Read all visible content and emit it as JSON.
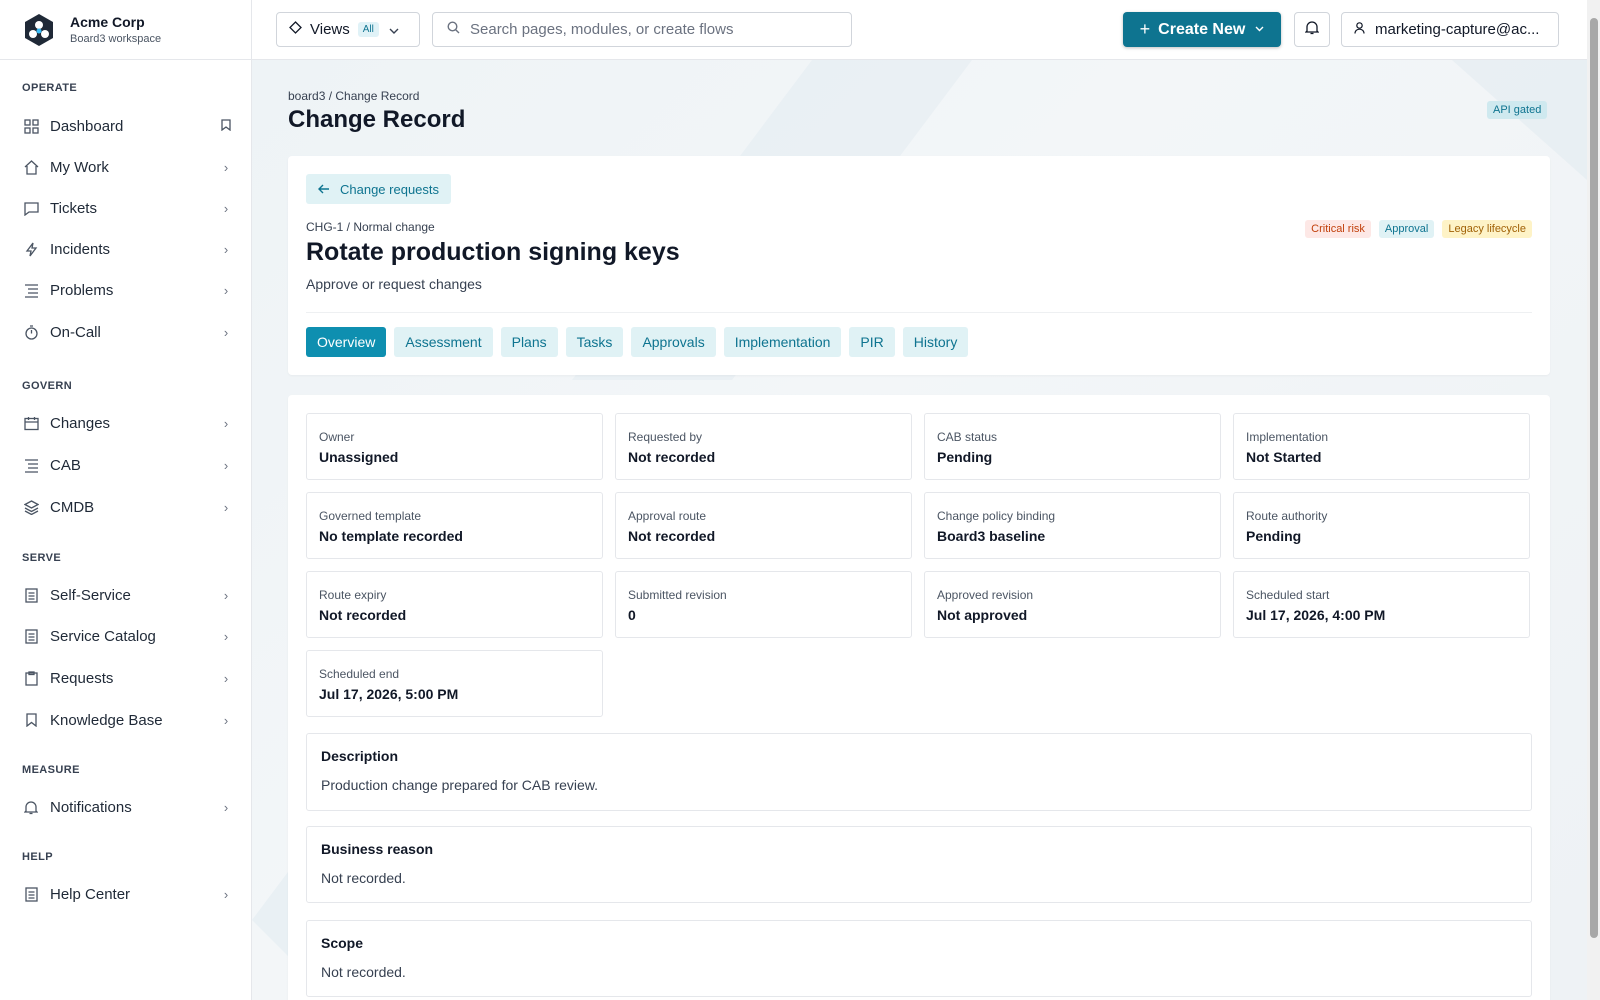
{
  "brand": {
    "name": "Acme Corp",
    "workspace": "Board3 workspace"
  },
  "sidebar": {
    "sections": [
      {
        "label": "OPERATE"
      },
      {
        "label": "GOVERN"
      },
      {
        "label": "SERVE"
      },
      {
        "label": "MEASURE"
      },
      {
        "label": "HELP"
      }
    ],
    "items": [
      {
        "label": "Dashboard",
        "icon": "grid-icon"
      },
      {
        "label": "My Work",
        "icon": "home-icon"
      },
      {
        "label": "Tickets",
        "icon": "chat-icon"
      },
      {
        "label": "Incidents",
        "icon": "bolt-icon"
      },
      {
        "label": "Problems",
        "icon": "list-icon"
      },
      {
        "label": "On-Call",
        "icon": "stopwatch-icon"
      },
      {
        "label": "Changes",
        "icon": "calendar-icon"
      },
      {
        "label": "CAB",
        "icon": "list-icon"
      },
      {
        "label": "CMDB",
        "icon": "layers-icon"
      },
      {
        "label": "Self-Service",
        "icon": "document-icon"
      },
      {
        "label": "Service Catalog",
        "icon": "document-icon"
      },
      {
        "label": "Requests",
        "icon": "clipboard-icon"
      },
      {
        "label": "Knowledge Base",
        "icon": "bookmark-icon"
      },
      {
        "label": "Notifications",
        "icon": "bell-icon"
      },
      {
        "label": "Help Center",
        "icon": "document-icon"
      }
    ]
  },
  "topbar": {
    "views_label": "Views",
    "views_badge": "All",
    "search_placeholder": "Search pages, modules, or create flows",
    "create_label": "Create New",
    "user_label": "marketing-capture@ac..."
  },
  "page": {
    "breadcrumb": "board3 / Change Record",
    "title": "Change Record",
    "api_badge": "API gated"
  },
  "record": {
    "back_label": "Change requests",
    "id_line": "CHG-1 / Normal change",
    "title": "Rotate production signing keys",
    "subtitle": "Approve or request changes",
    "tags": [
      "Critical risk",
      "Approval",
      "Legacy lifecycle"
    ],
    "tabs": [
      "Overview",
      "Assessment",
      "Plans",
      "Tasks",
      "Approvals",
      "Implementation",
      "PIR",
      "History"
    ],
    "active_tab": "Overview"
  },
  "fields": [
    {
      "label": "Owner",
      "value": "Unassigned"
    },
    {
      "label": "Requested by",
      "value": "Not recorded"
    },
    {
      "label": "CAB status",
      "value": "Pending"
    },
    {
      "label": "Implementation",
      "value": "Not Started"
    },
    {
      "label": "Governed template",
      "value": "No template recorded"
    },
    {
      "label": "Approval route",
      "value": "Not recorded"
    },
    {
      "label": "Change policy binding",
      "value": "Board3 baseline"
    },
    {
      "label": "Route authority",
      "value": "Pending"
    },
    {
      "label": "Route expiry",
      "value": "Not recorded"
    },
    {
      "label": "Submitted revision",
      "value": "0"
    },
    {
      "label": "Approved revision",
      "value": "Not approved"
    },
    {
      "label": "Scheduled start",
      "value": "Jul 17, 2026, 4:00 PM"
    },
    {
      "label": "Scheduled end",
      "value": "Jul 17, 2026, 5:00 PM"
    }
  ],
  "sections": [
    {
      "heading": "Description",
      "text": "Production change prepared for CAB review."
    },
    {
      "heading": "Business reason",
      "text": "Not recorded."
    },
    {
      "heading": "Scope",
      "text": "Not recorded."
    }
  ],
  "colors": {
    "accent": "#0e7490",
    "active_tab": "#0e8fb0"
  }
}
